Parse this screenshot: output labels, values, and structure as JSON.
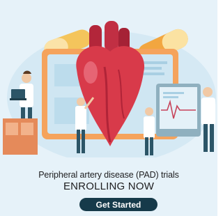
{
  "banner": {
    "headline": "Peripheral artery disease (PAD) trials",
    "subhead": "ENROLLING NOW",
    "cta_label": "Get Started"
  },
  "colors": {
    "background": "#e6f2f9",
    "heart": "#d83a4a",
    "cta_background": "#163a4a",
    "monitor_frame": "#f5a35c",
    "screen": "#cfe6f2"
  },
  "icons": [
    "heart-illustration",
    "monitor-illustration",
    "doctor-figure",
    "pill-capsule-icon",
    "laptop-icon"
  ]
}
